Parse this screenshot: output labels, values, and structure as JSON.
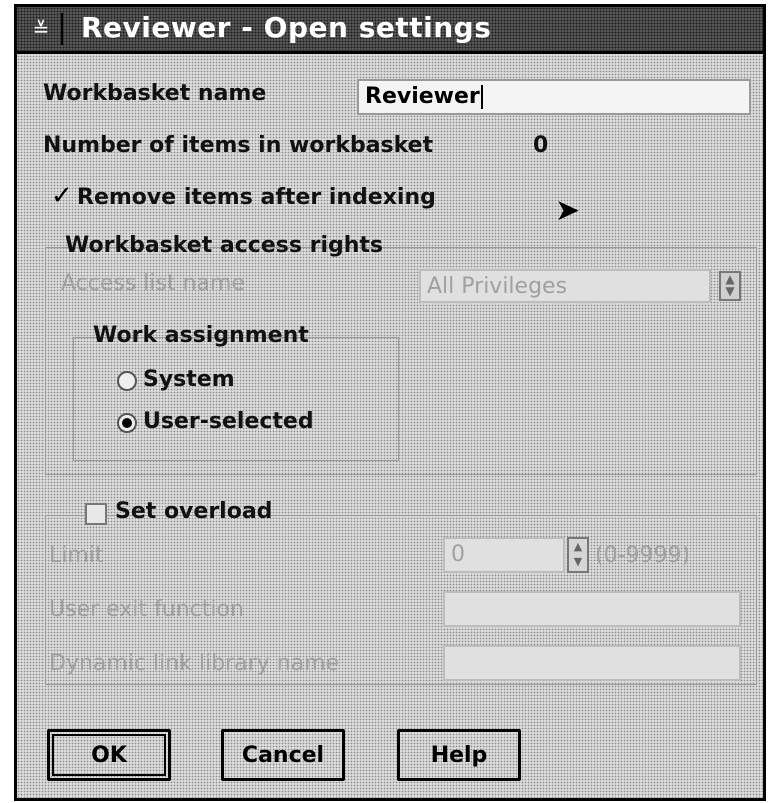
{
  "window": {
    "title": "Reviewer - Open settings",
    "system_menu_glyph": "≚"
  },
  "fields": {
    "workbasket_name_label": "Workbasket name",
    "workbasket_name_value": "Reviewer",
    "item_count_label": "Number of items in workbasket",
    "item_count_value": "0",
    "remove_items_label": "Remove items after indexing",
    "remove_items_checked": true
  },
  "access_rights": {
    "group_title": "Workbasket access rights",
    "access_list_label": "Access list name",
    "access_list_value": "All Privileges",
    "work_assignment_title": "Work assignment",
    "options": [
      {
        "label": "System",
        "selected": false
      },
      {
        "label": "User-selected",
        "selected": true
      }
    ]
  },
  "overload": {
    "checkbox_label": "Set overload",
    "checked": false,
    "limit_label": "Limit",
    "limit_value": "0",
    "limit_range": "(0-9999)",
    "user_exit_label": "User exit function",
    "dll_label": "Dynamic link library name"
  },
  "buttons": {
    "ok": "OK",
    "cancel": "Cancel",
    "help": "Help"
  }
}
